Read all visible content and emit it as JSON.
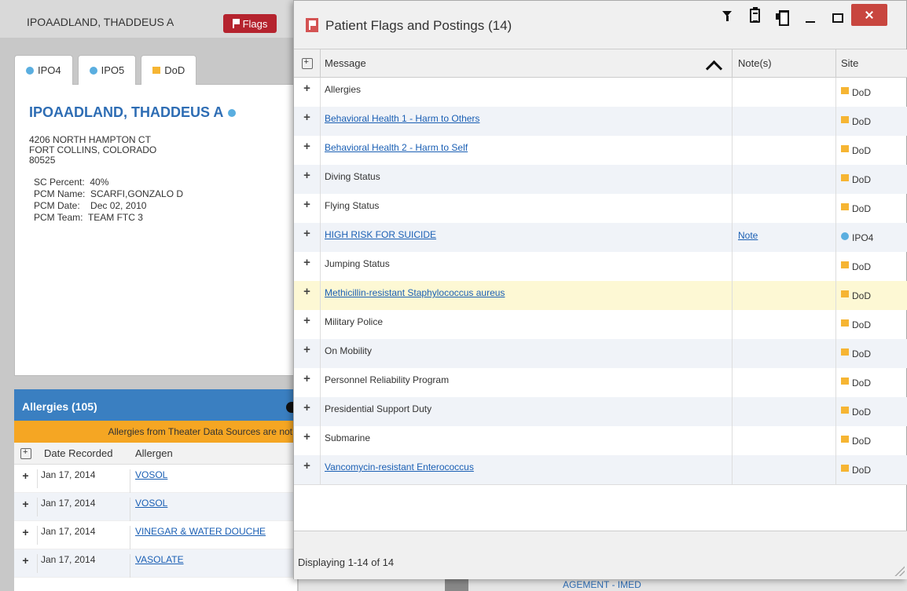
{
  "patient": {
    "header_name": "IPOAADLAND, THADDEUS A",
    "flags_label": "Flags",
    "tabs": [
      {
        "label": "IPO4",
        "marker": "dot"
      },
      {
        "label": "IPO5",
        "marker": "dot"
      },
      {
        "label": "DoD",
        "marker": "square"
      }
    ],
    "name": "IPOAADLAND, THADDEUS A",
    "address": [
      "4206 NORTH HAMPTON CT",
      "FORT COLLINS, COLORADO",
      "80525"
    ],
    "sc_percent_label": "SC Percent:",
    "sc_percent": "40%",
    "pcm_name_label": "PCM Name:",
    "pcm_name": "SCARFI,GONZALO D",
    "pcm_date_label": "PCM Date:",
    "pcm_date": "Dec 02, 2010",
    "pcm_team_label": "PCM Team:",
    "pcm_team": "TEAM FTC 3"
  },
  "allergies": {
    "title": "Allergies (105)",
    "warning": "Allergies from Theater Data Sources are not",
    "col_date": "Date Recorded",
    "col_allergen": "Allergen",
    "rows": [
      {
        "date": "Jan 17, 2014",
        "allergen": "VOSOL"
      },
      {
        "date": "Jan 17, 2014",
        "allergen": "VOSOL"
      },
      {
        "date": "Jan 17, 2014",
        "allergen": "VINEGAR & WATER DOUCHE"
      },
      {
        "date": "Jan 17, 2014",
        "allergen": "VASOLATE"
      }
    ]
  },
  "background_partial_text": "AGEMENT - IMED",
  "modal": {
    "title": "Patient Flags and Postings (14)",
    "columns": {
      "message": "Message",
      "notes": "Note(s)",
      "site": "Site"
    },
    "rows": [
      {
        "message": "Allergies",
        "link": false,
        "note": "",
        "site": "DoD",
        "site_marker": "square"
      },
      {
        "message": "Behavioral Health 1 - Harm to Others",
        "link": true,
        "note": "",
        "site": "DoD",
        "site_marker": "square"
      },
      {
        "message": "Behavioral Health 2 - Harm to Self",
        "link": true,
        "note": "",
        "site": "DoD",
        "site_marker": "square"
      },
      {
        "message": "Diving Status",
        "link": false,
        "note": "",
        "site": "DoD",
        "site_marker": "square"
      },
      {
        "message": "Flying Status",
        "link": false,
        "note": "",
        "site": "DoD",
        "site_marker": "square"
      },
      {
        "message": "HIGH RISK FOR SUICIDE",
        "link": true,
        "note": "Note",
        "site": "IPO4",
        "site_marker": "dot"
      },
      {
        "message": "Jumping Status",
        "link": false,
        "note": "",
        "site": "DoD",
        "site_marker": "square"
      },
      {
        "message": "Methicillin-resistant Staphylococcus aureus",
        "link": true,
        "note": "",
        "site": "DoD",
        "site_marker": "square",
        "highlighted": true
      },
      {
        "message": "Military Police",
        "link": false,
        "note": "",
        "site": "DoD",
        "site_marker": "square"
      },
      {
        "message": "On Mobility",
        "link": false,
        "note": "",
        "site": "DoD",
        "site_marker": "square"
      },
      {
        "message": "Personnel Reliability Program",
        "link": false,
        "note": "",
        "site": "DoD",
        "site_marker": "square"
      },
      {
        "message": "Presidential Support Duty",
        "link": false,
        "note": "",
        "site": "DoD",
        "site_marker": "square"
      },
      {
        "message": "Submarine",
        "link": false,
        "note": "",
        "site": "DoD",
        "site_marker": "square"
      },
      {
        "message": "Vancomycin-resistant Enterococcus",
        "link": true,
        "note": "",
        "site": "DoD",
        "site_marker": "square"
      }
    ],
    "footer": "Displaying 1-14 of 14",
    "icons": [
      "filter-icon",
      "clipboard-icon",
      "print-icon",
      "minimize-icon",
      "maximize-icon",
      "close-icon"
    ]
  },
  "colors": {
    "flag_red": "#b5232e",
    "link_blue": "#1a5fb4",
    "dod_orange": "#f6b533",
    "site_dot_blue": "#5aaee0",
    "allergy_header_blue": "#3a7fc1",
    "warning_orange": "#f5a623",
    "close_red": "#c8463f"
  }
}
